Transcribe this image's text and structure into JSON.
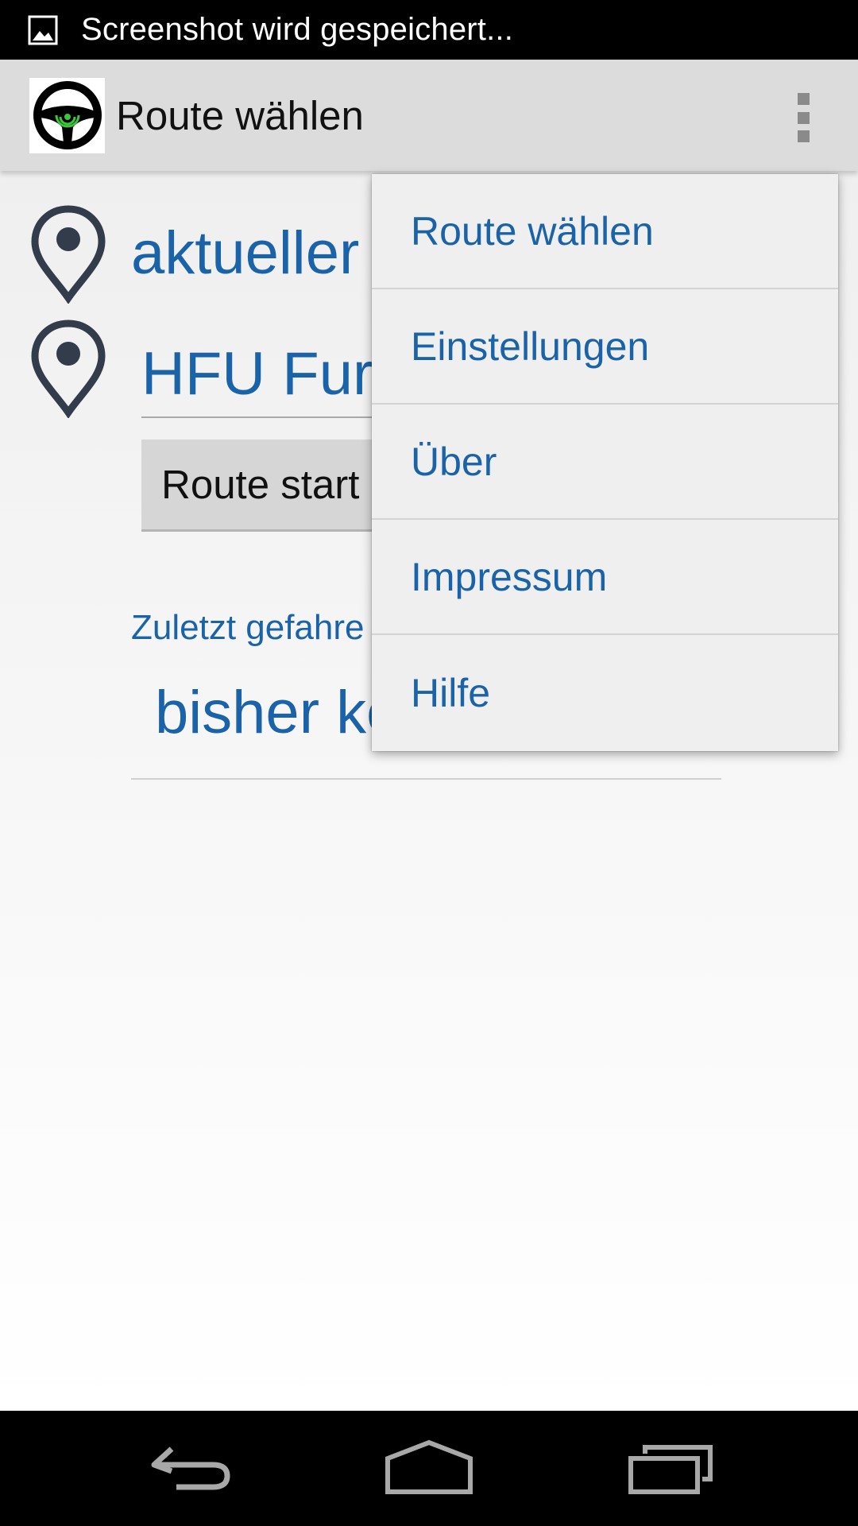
{
  "status_bar": {
    "notification_text": "Screenshot wird gespeichert...",
    "icon": "image-icon"
  },
  "action_bar": {
    "title": "Route wählen",
    "logo_icon": "steering-wheel-logo",
    "overflow_icon": "overflow-menu-icon"
  },
  "route": {
    "start_location": "aktueller",
    "destination": "HFU Furt",
    "start_button_label": "Route start",
    "recent_label": "Zuletzt gefahre",
    "recent_empty_text": "bisher ke"
  },
  "menu": {
    "items": [
      {
        "label": "Route wählen"
      },
      {
        "label": "Einstellungen"
      },
      {
        "label": "Über"
      },
      {
        "label": "Impressum"
      },
      {
        "label": "Hilfe"
      }
    ]
  },
  "nav_bar": {
    "icons": [
      "back-icon",
      "home-icon",
      "recents-icon"
    ]
  },
  "colors": {
    "accent": "#1a63a8",
    "pin": "#333c4a",
    "logo_green": "#3dc43d"
  }
}
